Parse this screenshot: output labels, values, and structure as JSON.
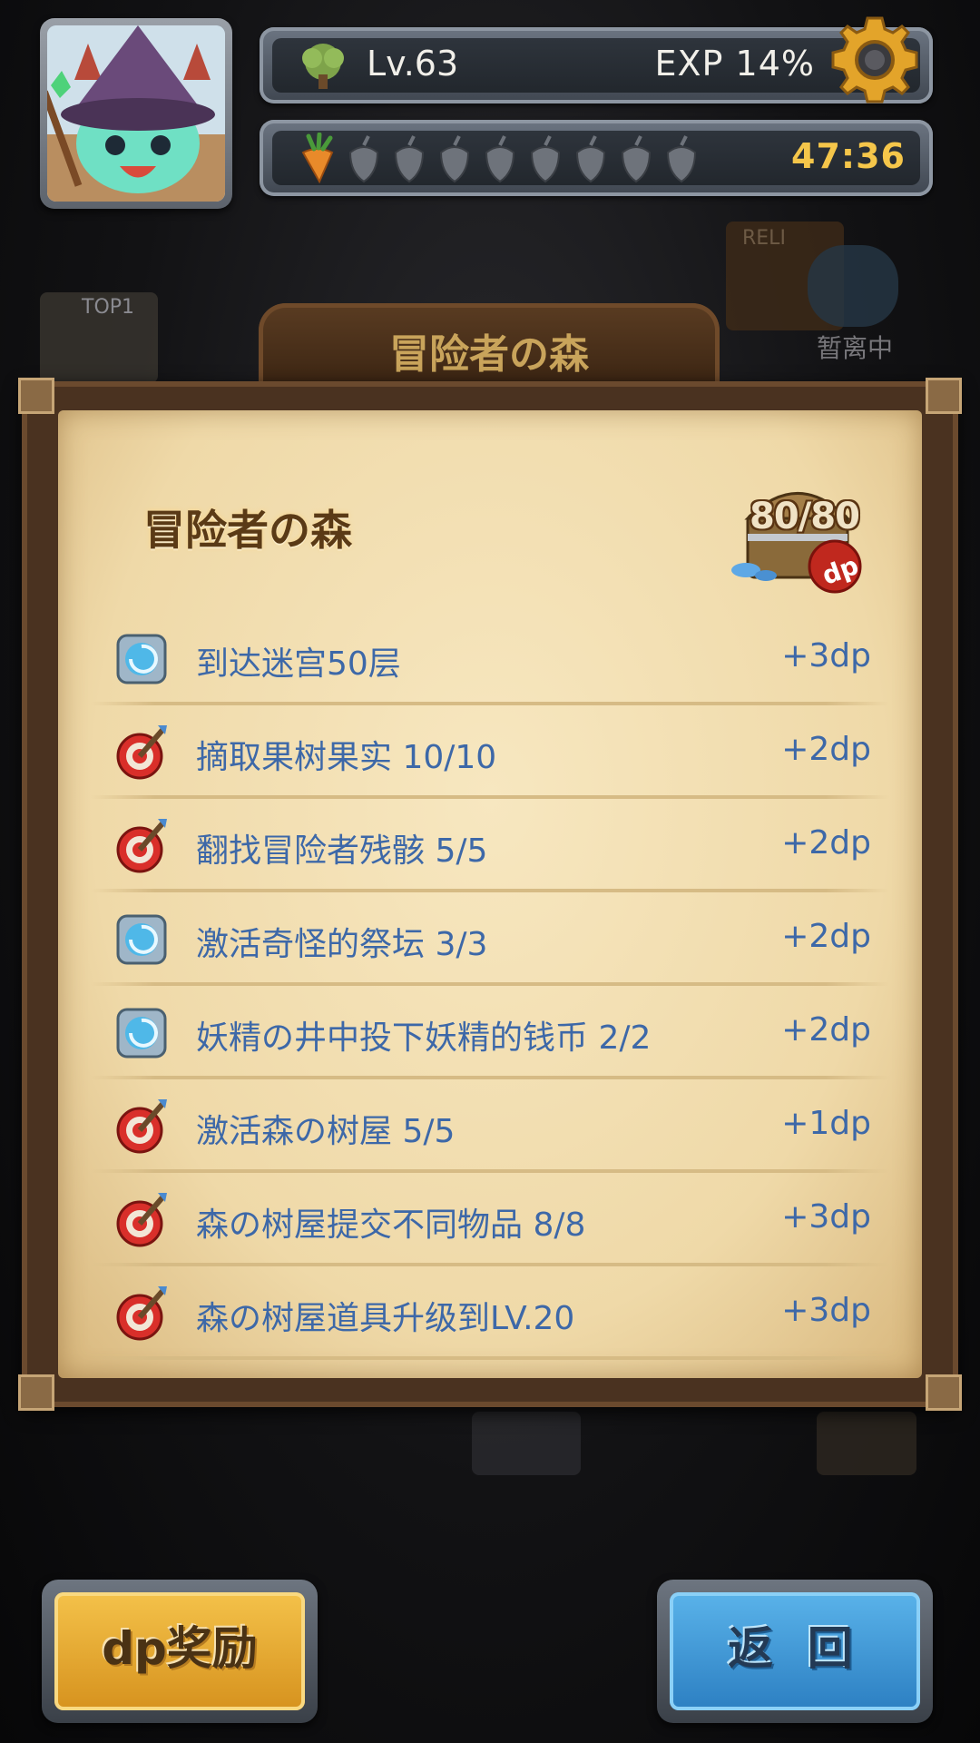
{
  "header": {
    "level": "Lv.63",
    "exp": "EXP 14%",
    "exp_percent": 14,
    "timer": "47:36",
    "stamina_full": 1,
    "stamina_total": 9
  },
  "background": {
    "sign_top": "TOP1",
    "status_label": "暂离中",
    "relic_label": "RELI"
  },
  "plank": {
    "title": "冒险者の森"
  },
  "panel": {
    "title": "冒险者の森",
    "dp_count": "80/80",
    "dp_badge": "dp",
    "tasks": [
      {
        "icon": "portal-icon",
        "text": "到达迷宫50层",
        "reward": "+3dp"
      },
      {
        "icon": "target-icon",
        "text": "摘取果树果实 10/10",
        "reward": "+2dp"
      },
      {
        "icon": "target-icon",
        "text": "翻找冒险者残骸 5/5",
        "reward": "+2dp"
      },
      {
        "icon": "portal-icon",
        "text": "激活奇怪的祭坛 3/3",
        "reward": "+2dp"
      },
      {
        "icon": "portal-icon",
        "text": "妖精の井中投下妖精的钱币 2/2",
        "reward": "+2dp"
      },
      {
        "icon": "target-icon",
        "text": "激活森の树屋 5/5",
        "reward": "+1dp"
      },
      {
        "icon": "target-icon",
        "text": "森の树屋提交不同物品 8/8",
        "reward": "+3dp"
      },
      {
        "icon": "target-icon",
        "text": "森の树屋道具升级到LV.20",
        "reward": "+3dp"
      }
    ]
  },
  "buttons": {
    "dp_reward": "dp奖励",
    "back": "返 回"
  },
  "colors": {
    "task_text": "#3d68a8",
    "timer": "#f5c64a",
    "button_gold": "#f4c24a",
    "button_blue": "#5ab3ea"
  }
}
